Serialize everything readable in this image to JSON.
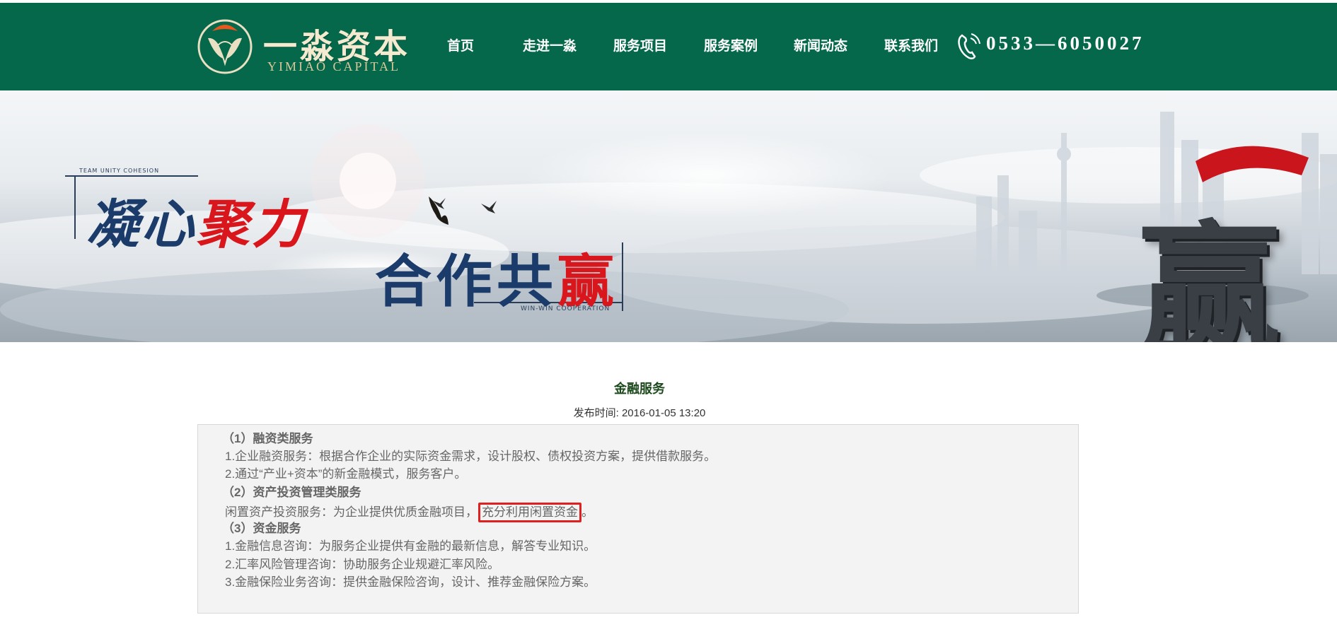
{
  "header": {
    "logo_cn": "一淼资本",
    "logo_en": "YIMIAO CAPITAL",
    "nav": [
      {
        "label": "首页"
      },
      {
        "label": "走进一淼"
      },
      {
        "label": "服务项目"
      },
      {
        "label": "服务案例"
      },
      {
        "label": "新闻动态"
      },
      {
        "label": "联系我们"
      }
    ],
    "phone": "0533—6050027"
  },
  "banner": {
    "slogan1_a": "凝心",
    "slogan1_b": "聚力",
    "slogan2_a": "合作共",
    "slogan2_b": "赢",
    "tag_top": "TEAM UNITY COHESION",
    "tag_bottom": "WIN-WIN COOPERATION",
    "win_char": "赢"
  },
  "article": {
    "title": "金融服务",
    "meta": "发布时间: 2016-01-05 13:20",
    "lines": [
      "（1）融资类服务",
      "1.企业融资服务：根据合作企业的实际资金需求，设计股权、债权投资方案，提供借款服务。",
      "2.通过“产业+资本”的新金融模式，服务客户。",
      "（2）资产投资管理类服务",
      "闲置资产投资服务：为企业提供优质金融项目，",
      "充分利用闲置资金",
      "。",
      "（3）资金服务",
      "1.金融信息咨询：为服务企业提供有金融的最新信息，解答专业知识。",
      "2.汇率风险管理咨询：协助服务企业规避汇率风险。",
      "3.金融保险业务咨询：提供金融保险咨询，设计、推荐金融保险方案。"
    ]
  },
  "colors": {
    "header_bg": "#06684a",
    "accent_red": "#d8161c",
    "slogan_blue": "#1b3c6b",
    "highlight_box": "#e02020"
  }
}
